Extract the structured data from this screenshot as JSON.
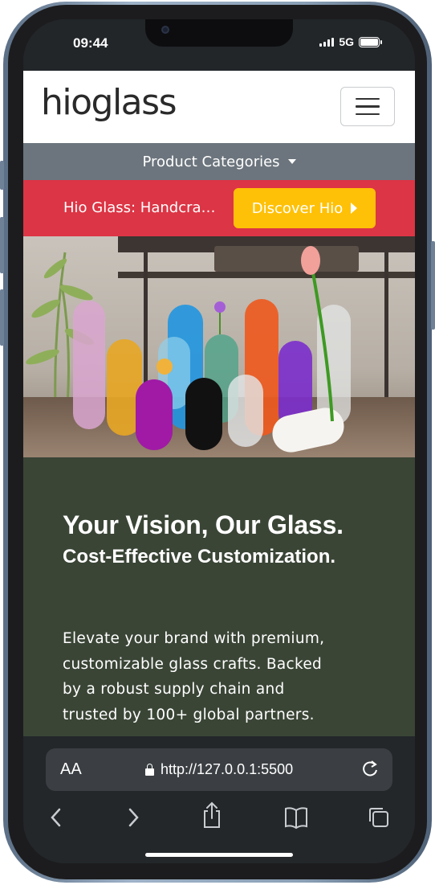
{
  "status_bar": {
    "time": "09:44",
    "network": "5G"
  },
  "header": {
    "logo": "hioglass",
    "menu_icon": "hamburger-menu-icon"
  },
  "categories": {
    "label": "Product Categories"
  },
  "promo": {
    "text": "Hio Glass: Handcrafted",
    "button_label": "Discover Hio"
  },
  "hero": {
    "heading": "Your Vision, Our Glass.",
    "subheading": "Cost-Effective Customization.",
    "paragraph": "Elevate your brand with premium, customizable glass crafts. Backed by a robust supply chain and trusted by 100+ global partners."
  },
  "browser": {
    "text_size_label": "AA",
    "url": "http://127.0.0.1:5500"
  },
  "colors": {
    "promo_bg": "#dc3545",
    "button_bg": "#ffc107",
    "categories_bg": "#6c757d",
    "content_bg": "#3a4536"
  },
  "icons": [
    "back-icon",
    "forward-icon",
    "share-icon",
    "bookmarks-icon",
    "tabs-icon",
    "reload-icon",
    "lock-icon"
  ]
}
